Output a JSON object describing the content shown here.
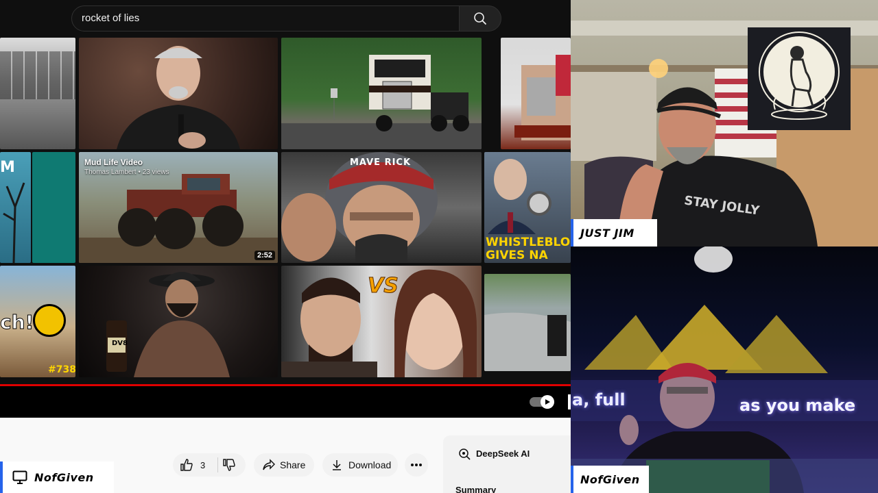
{
  "search": {
    "query": "rocket of lies"
  },
  "grid": {
    "mud_life": {
      "title": "Mud Life Video",
      "channel_meta": "Thomas Lambert • 23 views",
      "duration": "2:52"
    },
    "top_gun": {
      "helmet_text": "MAVE RICK"
    },
    "whistleblower": {
      "headline_1": "WHISTLEBLO",
      "headline_2": "GIVES NA"
    },
    "left_strip": {
      "letters": "M",
      "ch_text": "ch!",
      "episode": "#738"
    },
    "vs_tile": {
      "vs_text": "VS"
    },
    "whiskey": {
      "bottle_label": "DV8"
    }
  },
  "actions": {
    "like_count": "3",
    "share_label": "Share",
    "download_label": "Download"
  },
  "ai_panel": {
    "label": "DeepSeek AI",
    "summary_label": "Summary"
  },
  "participants": {
    "screen_share_name": "NofGiven",
    "top_cam_name": "JUST JIM",
    "bottom_cam_name": "NofGiven"
  },
  "colors": {
    "progress_red": "#e00000",
    "name_tag_accent": "#2563eb",
    "youtube_dark": "#0f0f0f"
  },
  "webcam_text": {
    "shirt_text": "STAY JOLLY",
    "neon_left": "a, full",
    "neon_right": "as you make"
  }
}
